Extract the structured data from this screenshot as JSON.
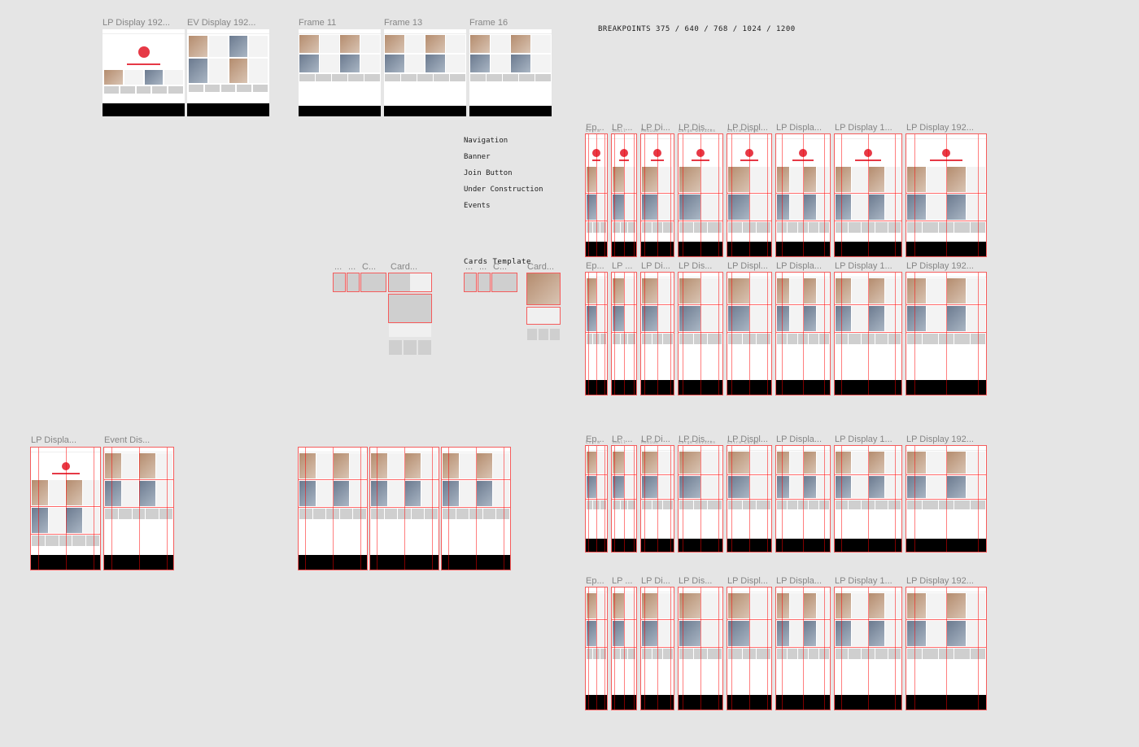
{
  "breakpoints_label": "BREAKPOINTS 375 / 640 / 768 / 1024 / 1200",
  "component_list": [
    "Navigation",
    "Banner",
    "Join Button",
    "Under Construction",
    "Events"
  ],
  "cards_template_label": "Cards Template",
  "top_frames": [
    {
      "label": "LP Display 192...",
      "kind": "lp"
    },
    {
      "label": "EV Display 192...",
      "kind": "ev"
    }
  ],
  "top_frames_b": [
    {
      "label": "Frame 11"
    },
    {
      "label": "Frame 13"
    },
    {
      "label": "Frame 16"
    }
  ],
  "bp_tiny_labels": [
    "Extra Small Devices",
    "Small Devices",
    "Medium Devices",
    "Large Devices",
    "Extra Large Devices"
  ],
  "bp_cols": [
    {
      "label": "Ep..."
    },
    {
      "label": "LP ..."
    },
    {
      "label": "LP Di..."
    },
    {
      "label": "LP Dis..."
    },
    {
      "label": "LP Displ..."
    },
    {
      "label": "LP Displa..."
    },
    {
      "label": "LP Display 1..."
    },
    {
      "label": "LP Display 192..."
    }
  ],
  "bp_cols_ev": [
    {
      "label": "Ep..."
    },
    {
      "label": "LP ..."
    },
    {
      "label": "LP Di..."
    },
    {
      "label": "LP Dis..."
    },
    {
      "label": "LP Displ..."
    },
    {
      "label": "LP Displa..."
    },
    {
      "label": "LP Display 1..."
    },
    {
      "label": "LP Display 192..."
    }
  ],
  "bottom_left": [
    {
      "label": "LP Displa..."
    },
    {
      "label": "Event Dis..."
    }
  ],
  "card_cluster_a_labels": [
    "...",
    "...",
    "C...",
    "Card..."
  ],
  "card_cluster_b_labels": [
    "...",
    "...",
    "C...",
    "Card..."
  ],
  "colors": {
    "accent": "#e63946",
    "grid": "#ff0000"
  }
}
